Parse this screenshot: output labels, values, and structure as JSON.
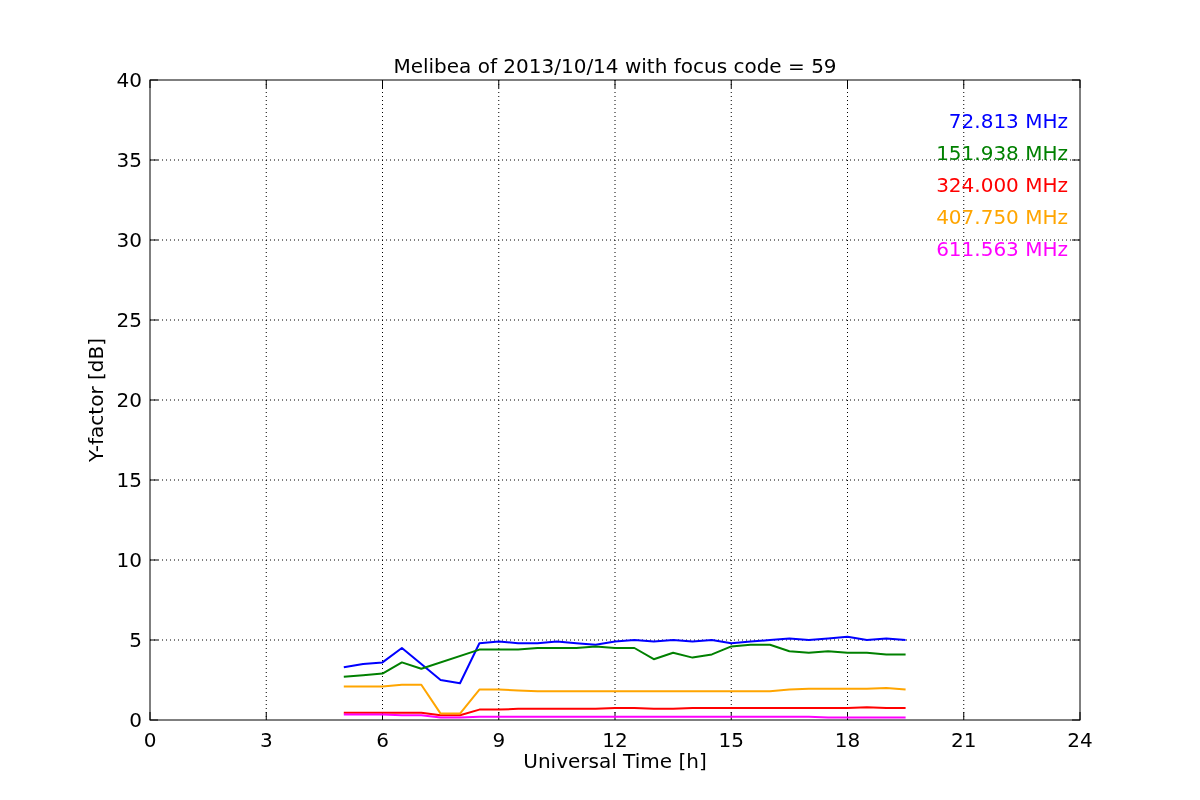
{
  "figure": {
    "chart_data": {
      "type": "line",
      "title": "Melibea of 2013/10/14 with focus code = 59",
      "xlabel": "Universal Time [h]",
      "ylabel": "Y-factor [dB]",
      "x": [
        5,
        5.5,
        6,
        6.5,
        7,
        7.5,
        8,
        8.5,
        9,
        9.5,
        10,
        10.5,
        11,
        11.5,
        12,
        12.5,
        13,
        13.5,
        14,
        14.5,
        15,
        15.5,
        16,
        16.5,
        17,
        17.5,
        18,
        18.5,
        19,
        19.5
      ],
      "series": [
        {
          "name": "72.813 MHz",
          "color": "#0000ff",
          "values": [
            3.3,
            3.5,
            3.6,
            4.5,
            3.5,
            2.5,
            2.3,
            4.8,
            4.9,
            4.8,
            4.8,
            4.9,
            4.8,
            4.7,
            4.9,
            5.0,
            4.9,
            5.0,
            4.9,
            5.0,
            4.8,
            4.9,
            5.0,
            5.1,
            5.0,
            5.1,
            5.2,
            5.0,
            5.1,
            5.0
          ]
        },
        {
          "name": "151.938 MHz",
          "color": "#008000",
          "values": [
            2.7,
            2.8,
            2.9,
            3.6,
            3.2,
            null,
            null,
            4.4,
            4.4,
            4.4,
            4.5,
            4.5,
            4.5,
            4.6,
            4.5,
            4.5,
            3.8,
            4.2,
            3.9,
            4.1,
            4.6,
            4.7,
            4.7,
            4.3,
            4.2,
            4.3,
            4.2,
            4.2,
            4.1,
            4.1
          ]
        },
        {
          "name": "324.000 MHz",
          "color": "#ff0000",
          "values": [
            0.45,
            0.45,
            0.45,
            0.45,
            0.45,
            0.3,
            0.3,
            0.65,
            0.65,
            0.7,
            0.7,
            0.7,
            0.7,
            0.7,
            0.75,
            0.75,
            0.7,
            0.7,
            0.75,
            0.75,
            0.75,
            0.75,
            0.75,
            0.75,
            0.75,
            0.75,
            0.75,
            0.8,
            0.75,
            0.75
          ]
        },
        {
          "name": "407.750 MHz",
          "color": "#ffa500",
          "values": [
            2.1,
            2.1,
            2.1,
            2.2,
            2.2,
            0.4,
            0.4,
            1.9,
            1.9,
            1.85,
            1.8,
            1.8,
            1.8,
            1.8,
            1.8,
            1.8,
            1.8,
            1.8,
            1.8,
            1.8,
            1.8,
            1.8,
            1.8,
            1.9,
            1.95,
            1.95,
            1.95,
            1.95,
            2.0,
            1.9
          ]
        },
        {
          "name": "611.563 MHz",
          "color": "#ff00ff",
          "values": [
            0.35,
            0.35,
            0.35,
            0.3,
            0.3,
            0.15,
            0.15,
            0.2,
            0.2,
            0.2,
            0.2,
            0.2,
            0.2,
            0.2,
            0.2,
            0.2,
            0.2,
            0.2,
            0.2,
            0.2,
            0.2,
            0.2,
            0.2,
            0.2,
            0.2,
            0.15,
            0.15,
            0.15,
            0.15,
            0.15
          ]
        }
      ],
      "grid": true,
      "xlim": [
        0,
        24
      ],
      "ylim": [
        0,
        40
      ],
      "xticks": [
        0,
        3,
        6,
        9,
        12,
        15,
        18,
        21,
        24
      ],
      "yticks": [
        0,
        5,
        10,
        15,
        20,
        25,
        30,
        35,
        40
      ]
    }
  }
}
